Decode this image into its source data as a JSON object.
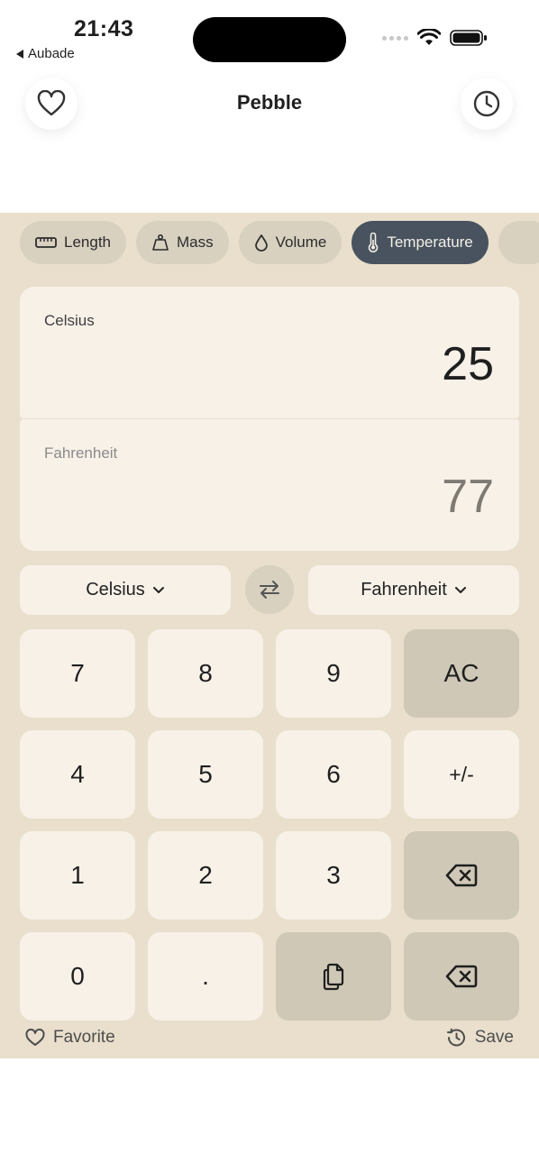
{
  "status_bar": {
    "time": "21:43",
    "back_app": "Aubade"
  },
  "header": {
    "title": "Pebble"
  },
  "categories": [
    {
      "label": "Length",
      "icon": "ruler-icon",
      "active": false
    },
    {
      "label": "Mass",
      "icon": "weight-icon",
      "active": false
    },
    {
      "label": "Volume",
      "icon": "drop-icon",
      "active": false
    },
    {
      "label": "Temperature",
      "icon": "thermometer-icon",
      "active": true
    }
  ],
  "input": {
    "unit": "Celsius",
    "value": "25"
  },
  "output": {
    "unit": "Fahrenheit",
    "value": "77"
  },
  "selectors": {
    "from": "Celsius",
    "to": "Fahrenheit"
  },
  "keypad": {
    "k7": "7",
    "k8": "8",
    "k9": "9",
    "clear": "AC",
    "k4": "4",
    "k5": "5",
    "k6": "6",
    "sign": "+/-",
    "k1": "1",
    "k2": "2",
    "k3": "3",
    "k0": "0",
    "dot": "."
  },
  "footer": {
    "favorite": "Favorite",
    "save": "Save"
  },
  "colors": {
    "panel": "#e9dfcc",
    "card": "#f7f1e8",
    "chip": "#d8d1c0",
    "chip_active": "#48535f",
    "key_dark": "#cfc8b7"
  }
}
